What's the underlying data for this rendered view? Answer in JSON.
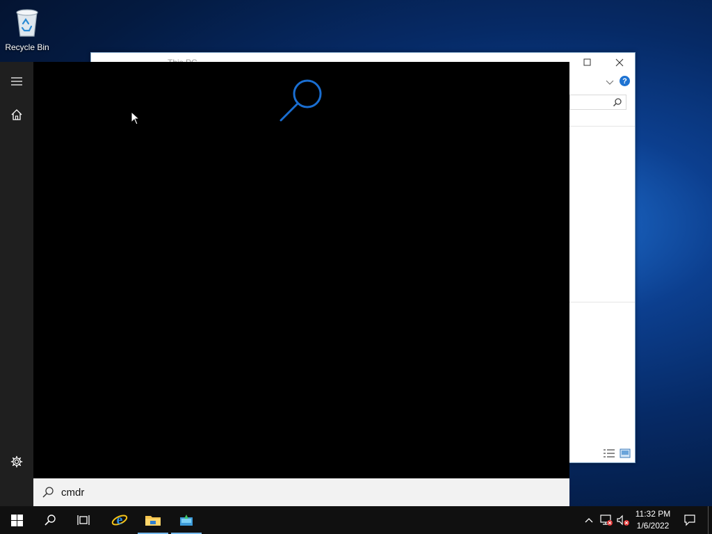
{
  "desktop": {
    "icons": [
      {
        "label": "Recycle Bin",
        "icon": "recycle-bin-icon"
      }
    ]
  },
  "explorer_window": {
    "title": "This PC",
    "help_label": "?"
  },
  "start_menu": {
    "rail": {
      "menu_icon": "hamburger-icon",
      "home_icon": "home-icon",
      "settings_icon": "gear-icon"
    },
    "search": {
      "query": "cmdr",
      "illustration_icon": "search-icon",
      "accent_color": "#1a6ed1"
    }
  },
  "taskbar": {
    "buttons": [
      {
        "name": "start",
        "icon": "windows-logo-icon"
      },
      {
        "name": "search",
        "icon": "search-icon"
      },
      {
        "name": "task-view",
        "icon": "task-view-icon"
      },
      {
        "name": "internet-explorer",
        "icon": "internet-explorer-icon"
      },
      {
        "name": "file-explorer",
        "icon": "folder-icon",
        "active": true
      },
      {
        "name": "app",
        "icon": "app-icon",
        "active": true
      }
    ],
    "tray": {
      "time": "11:32 PM",
      "date": "1/6/2022"
    }
  }
}
